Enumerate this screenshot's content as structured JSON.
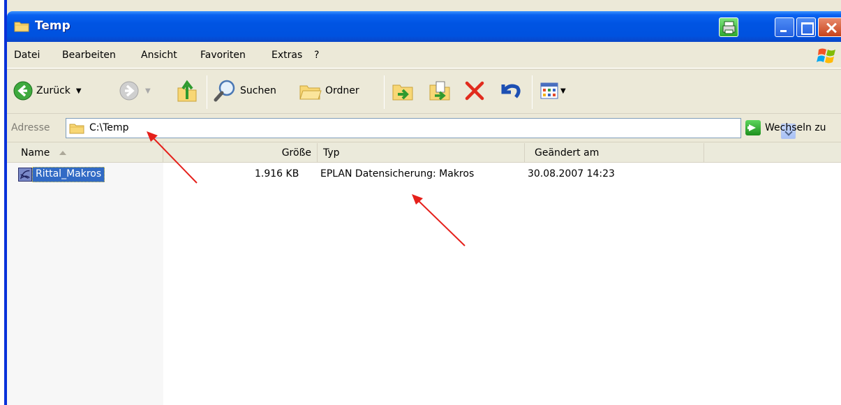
{
  "window": {
    "title": "Temp"
  },
  "menu": {
    "items": [
      "Datei",
      "Bearbeiten",
      "Ansicht",
      "Favoriten",
      "Extras",
      "?"
    ]
  },
  "toolbar": {
    "back_label": "Zurück",
    "search_label": "Suchen",
    "folders_label": "Ordner"
  },
  "address": {
    "label": "Adresse",
    "value": "C:\\Temp",
    "go_label": "Wechseln zu"
  },
  "list": {
    "columns": {
      "name": "Name",
      "size": "Größe",
      "type": "Typ",
      "modified": "Geändert am"
    },
    "rows": [
      {
        "name": "Rittal_Makros",
        "size": "1.916 KB",
        "type": "EPLAN Datensicherung: Makros",
        "modified": "30.08.2007 14:23"
      }
    ]
  },
  "colors": {
    "titlebar": "#0054e3",
    "selection": "#316ac5",
    "annotation_arrow": "#e5201b"
  }
}
